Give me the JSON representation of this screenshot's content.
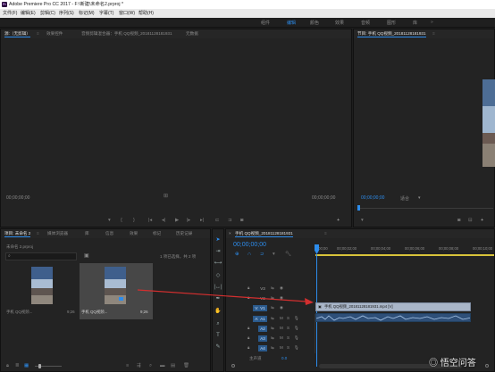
{
  "app": {
    "title": "Adobe Premiere Pro CC 2017 - F:\\新建\\未命名2.prproj *",
    "logo": "Pr"
  },
  "menu": [
    "文件(F)",
    "编辑(E)",
    "剪辑(C)",
    "序列(S)",
    "标记(M)",
    "字幕(T)",
    "窗口(W)",
    "帮助(H)"
  ],
  "workspaces": [
    "组件",
    "编辑",
    "颜色",
    "效果",
    "音频",
    "图形",
    "库"
  ],
  "source_panel": {
    "tabs": [
      "源:（无剪辑）",
      "效果控件",
      "音频剪辑混合器：手机 QQ视频_20181128181931",
      "元数据"
    ],
    "tc_left": "00;00;00;00",
    "tc_right": "00;00;00;00"
  },
  "program_panel": {
    "tab": "节目: 手机 QQ视频_20181128181931",
    "tc": "00;00;00;00",
    "fit": "适合"
  },
  "project_panel": {
    "tabs": [
      "项目: 未命名 2",
      "媒体浏览器",
      "库",
      "信息",
      "效果",
      "标记",
      "历史记录"
    ],
    "path": "未命名 2.prproj",
    "selection": "1 项已选择，共 2 项",
    "items": [
      {
        "name": "手机 QQ视频...",
        "duration": "9;26"
      },
      {
        "name": "手机 QQ视频...",
        "duration": "9;26"
      }
    ]
  },
  "timeline": {
    "tab": "手机 QQ视频_20181128181931",
    "tc": "00;00;00;00",
    "ruler": [
      ":00;00",
      "00;00;02;00",
      "00;00;04;00",
      "00;00;06;00",
      "00;00;08;00",
      "00;00;10;00"
    ],
    "video_tracks": [
      "V3",
      "V2",
      "V1"
    ],
    "audio_tracks": [
      "A1",
      "A2",
      "A3",
      "A4"
    ],
    "clip_label": "手机 QQ视频_20181128181931.mp4 [V]",
    "master_label": "主声道",
    "master_value": "0.0"
  },
  "colors": {
    "accent": "#2d8ceb",
    "arrow": "#d32f2f",
    "clip_video": "#a9b6c8"
  }
}
